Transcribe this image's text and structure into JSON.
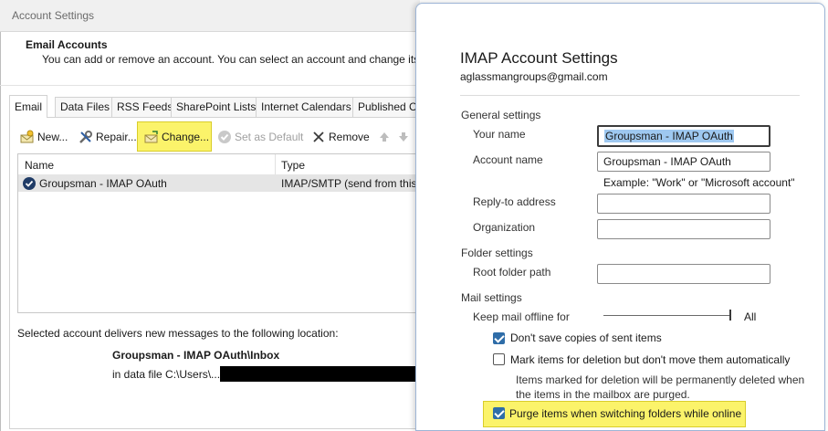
{
  "window": {
    "title": "Account Settings",
    "heading": "Email Accounts",
    "description": "You can add or remove an account. You can select an account and change its se"
  },
  "tabs": [
    {
      "label": "Email"
    },
    {
      "label": "Data Files"
    },
    {
      "label": "RSS Feeds"
    },
    {
      "label": "SharePoint Lists"
    },
    {
      "label": "Internet Calendars"
    },
    {
      "label": "Published Ca"
    }
  ],
  "toolbar": {
    "new_label": "New...",
    "repair_label": "Repair...",
    "change_label": "Change...",
    "set_default_label": "Set as Default",
    "remove_label": "Remove"
  },
  "accounts_list": {
    "columns": [
      "Name",
      "Type"
    ],
    "rows": [
      {
        "name": "Groupsman - IMAP OAuth",
        "type": "IMAP/SMTP (send from this ac"
      }
    ]
  },
  "delivery": {
    "label": "Selected account delivers new messages to the following location:",
    "path": "Groupsman - IMAP OAuth\\Inbox",
    "data_file_prefix": "in data file C:\\Users\\...\\"
  },
  "imap": {
    "title": "IMAP Account Settings",
    "email": "aglassmangroups@gmail.com",
    "general_settings": "General settings",
    "your_name_label": "Your name",
    "your_name_value": "Groupsman - IMAP OAuth",
    "account_name_label": "Account name",
    "account_name_value": "Groupsman - IMAP OAuth",
    "example": "Example: \"Work\" or \"Microsoft account\"",
    "reply_to_label": "Reply-to address",
    "reply_to_value": "",
    "organization_label": "Organization",
    "organization_value": "",
    "folder_settings": "Folder settings",
    "root_folder_label": "Root folder path",
    "root_folder_value": "",
    "mail_settings": "Mail settings",
    "keep_offline_label": "Keep mail offline for",
    "keep_offline_value": "All",
    "dont_save_sent": {
      "label": "Don't save copies of sent items",
      "checked": true
    },
    "mark_for_deletion": {
      "label": "Mark items for deletion but don't move them automatically",
      "checked": false
    },
    "mark_note_line1": "Items marked for deletion will be permanently deleted when",
    "mark_note_line2": "the items in the mailbox are purged.",
    "purge_items": {
      "label": "Purge items when switching folders while online",
      "checked": true
    }
  },
  "colors": {
    "highlight": "#fbf36a",
    "checkbox_on": "#2f6da8",
    "selection": "#9ec8f0"
  }
}
